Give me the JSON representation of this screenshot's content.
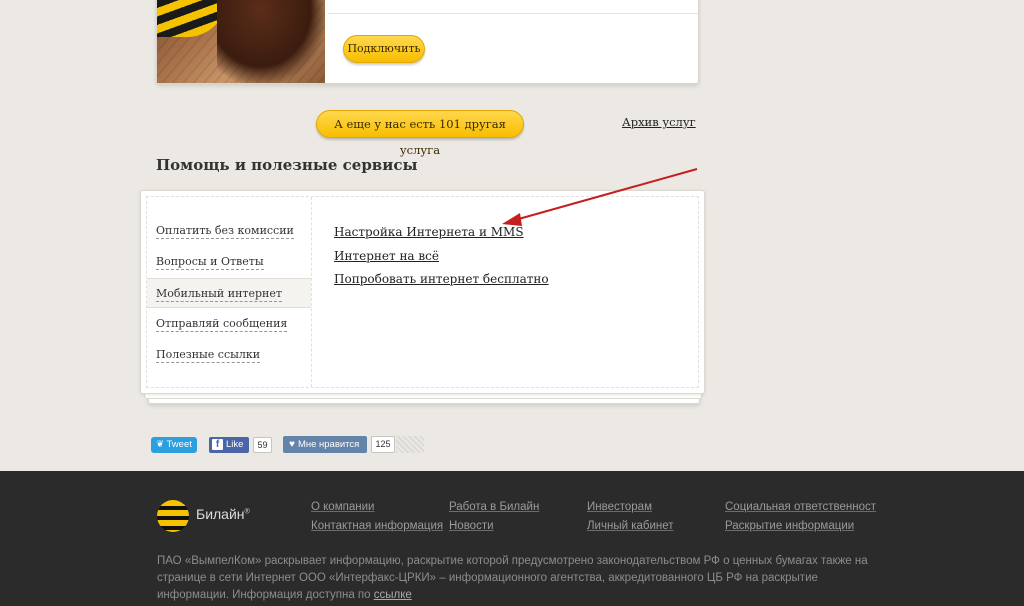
{
  "service_card": {
    "connect_label": "Подключить"
  },
  "more_services_label": "А еще у нас есть 101 другая услуга",
  "archive_link": "Архив услуг",
  "help": {
    "title": "Помощь и полезные сервисы",
    "nav": [
      {
        "label": "Оплатить без комиссии"
      },
      {
        "label": "Вопросы и Ответы"
      },
      {
        "label": "Мобильный интернет"
      },
      {
        "label": "Отправляй сообщения"
      },
      {
        "label": "Полезные ссылки"
      }
    ],
    "active_index": 2,
    "links": [
      {
        "label": "Настройка Интернета и MMS"
      },
      {
        "label": "Интернет на всё"
      },
      {
        "label": "Попробовать интернет бесплатно"
      }
    ]
  },
  "social": {
    "tweet_label": "Tweet",
    "fb_like_label": "Like",
    "fb_count": "59",
    "vk_label": "Мне нравится",
    "vk_count": "125"
  },
  "footer": {
    "logo_text": "Билайн",
    "links": [
      {
        "label": "О компании"
      },
      {
        "label": "Контактная информация"
      },
      {
        "label": "Работа в Билайн"
      },
      {
        "label": "Новости"
      },
      {
        "label": "Инвесторам"
      },
      {
        "label": "Личный кабинет"
      },
      {
        "label": "Социальная ответственност"
      },
      {
        "label": "Раскрытие информации"
      }
    ],
    "disclaimer": "ПАО «ВымпелКом» раскрывает информацию, раскрытие которой предусмотрено законодательством РФ о ценных бумагах также на странице в сети Интернет ООО «Интерфакс-ЦРКИ» – информационного агентства, аккредитованного ЦБ РФ на раскрытие информации. Информация доступна по ",
    "disclaimer_link": "ссылке"
  },
  "colors": {
    "accent_yellow": "#f7be00",
    "arrow_red": "#c41e1e",
    "footer_bg": "#2b2b2b"
  }
}
